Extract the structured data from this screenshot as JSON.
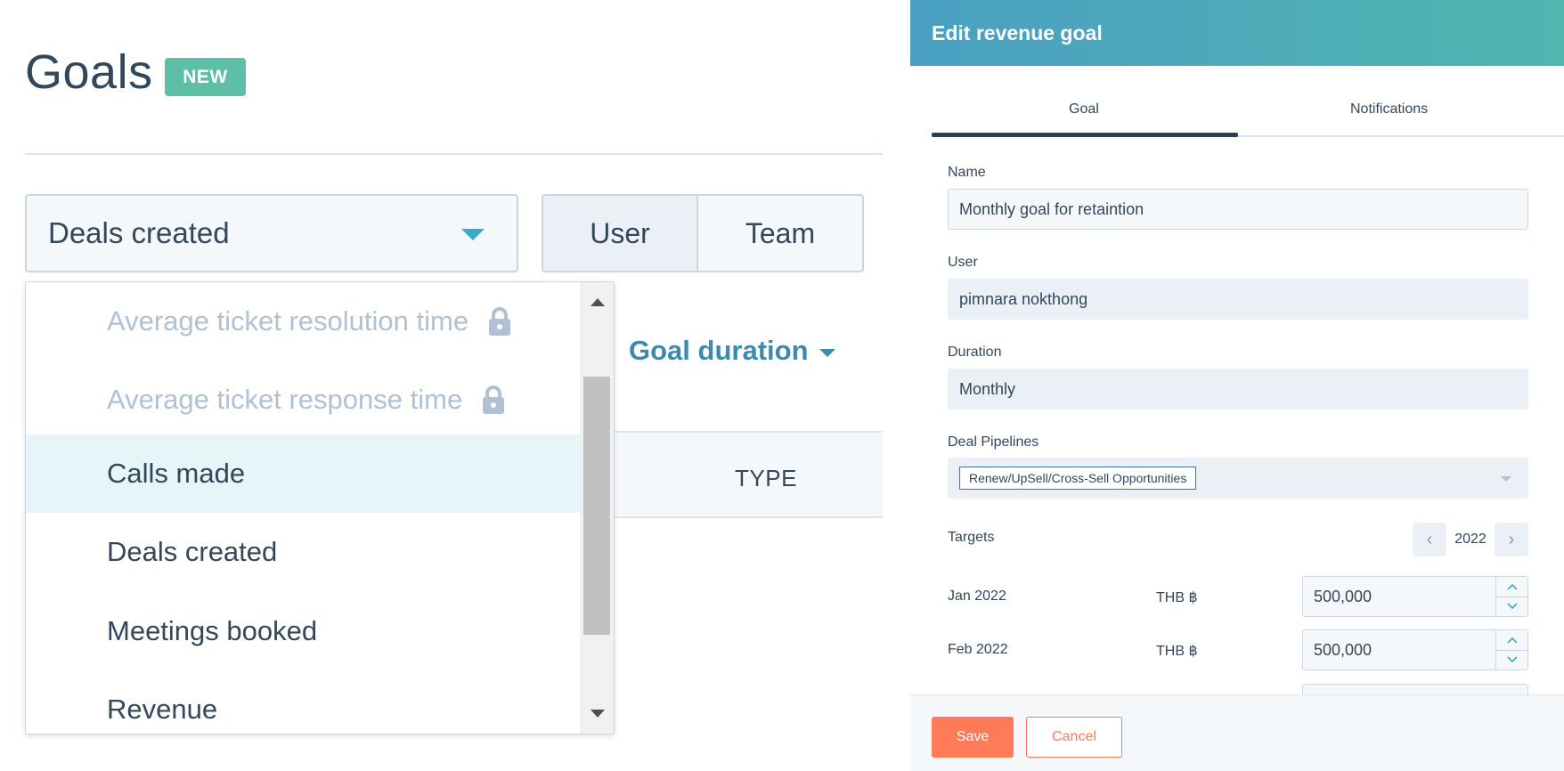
{
  "goals_page": {
    "title": "Goals",
    "badge": "NEW",
    "metric_select": {
      "value": "Deals created"
    },
    "assignee_toggle": [
      "User",
      "Team"
    ],
    "goal_duration_label": "Goal duration",
    "table": {
      "columns": [
        "TYPE"
      ]
    },
    "dropdown": {
      "items": [
        {
          "label": "Average ticket resolution time",
          "disabled": true,
          "locked": true
        },
        {
          "label": "Average ticket response time",
          "disabled": true,
          "locked": true
        },
        {
          "label": "Calls made",
          "disabled": false,
          "highlighted": true
        },
        {
          "label": "Deals created",
          "disabled": false
        },
        {
          "label": "Meetings booked",
          "disabled": false
        },
        {
          "label": "Revenue",
          "disabled": false
        }
      ],
      "scroll_position": 0.25
    }
  },
  "edit_panel": {
    "title": "Edit revenue goal",
    "tabs": {
      "goal": "Goal",
      "notifications": "Notifications",
      "active": "Goal"
    },
    "fields": {
      "name": {
        "label": "Name",
        "value": "Monthly goal for retaintion"
      },
      "user": {
        "label": "User",
        "value": "pimnara nokthong"
      },
      "duration": {
        "label": "Duration",
        "value": "Monthly"
      },
      "deal_pipelines": {
        "label": "Deal Pipelines",
        "selected": "Renew/UpSell/Cross-Sell Opportunities"
      }
    },
    "targets": {
      "label": "Targets",
      "year": "2022",
      "prev_glyph": "‹",
      "next_glyph": "›",
      "rows": [
        {
          "month": "Jan 2022",
          "currency": "THB ฿",
          "value": "500,000"
        },
        {
          "month": "Feb 2022",
          "currency": "THB ฿",
          "value": "500,000"
        }
      ]
    },
    "footer": {
      "save": "Save",
      "cancel": "Cancel"
    }
  },
  "colors": {
    "accent_teal": "#5cbfa6",
    "link_blue": "#3c8bae",
    "header_gradient_start": "#4a9fc1",
    "header_gradient_end": "#50b6b0",
    "primary_orange": "#ff7a59",
    "text_dark": "#33475b",
    "disabled_text": "#b0c1d4",
    "highlight_row": "#e5f5f8"
  },
  "icons": [
    "chevron-down-icon",
    "lock-icon",
    "chevron-left-icon",
    "chevron-right-icon",
    "caret-up-icon",
    "caret-down-icon"
  ]
}
